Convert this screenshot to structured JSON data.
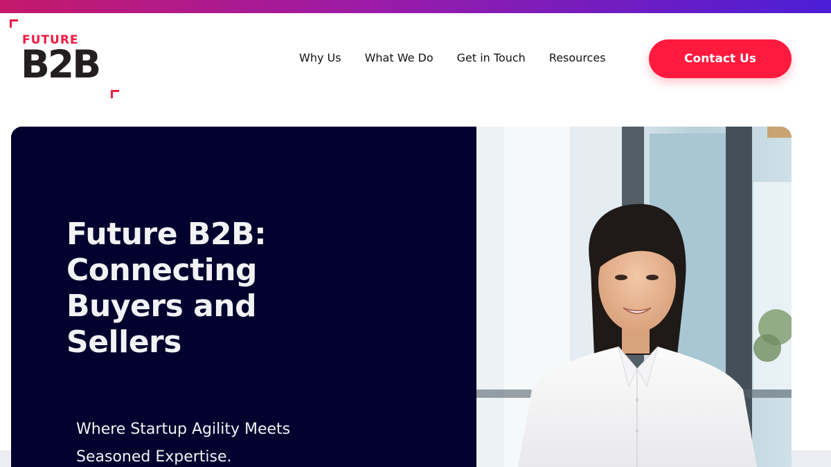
{
  "logo": {
    "top_word": "FUTURE",
    "main_word": "B2B"
  },
  "nav": {
    "items": [
      {
        "label": "Why Us"
      },
      {
        "label": "What We Do"
      },
      {
        "label": "Get in Touch"
      },
      {
        "label": "Resources"
      }
    ],
    "cta_label": "Contact Us"
  },
  "hero": {
    "title": "Future B2B: Connecting Buyers and Sellers",
    "subtitle": "Where Startup Agility Meets Seasoned Expertise."
  },
  "colors": {
    "accent": "#ff1a3e",
    "hero_background": "#03022e",
    "gradient_start": "#c5196b",
    "gradient_end": "#4b1ed6"
  },
  "icons": {
    "logo_corner": "corner-bracket-icon"
  }
}
